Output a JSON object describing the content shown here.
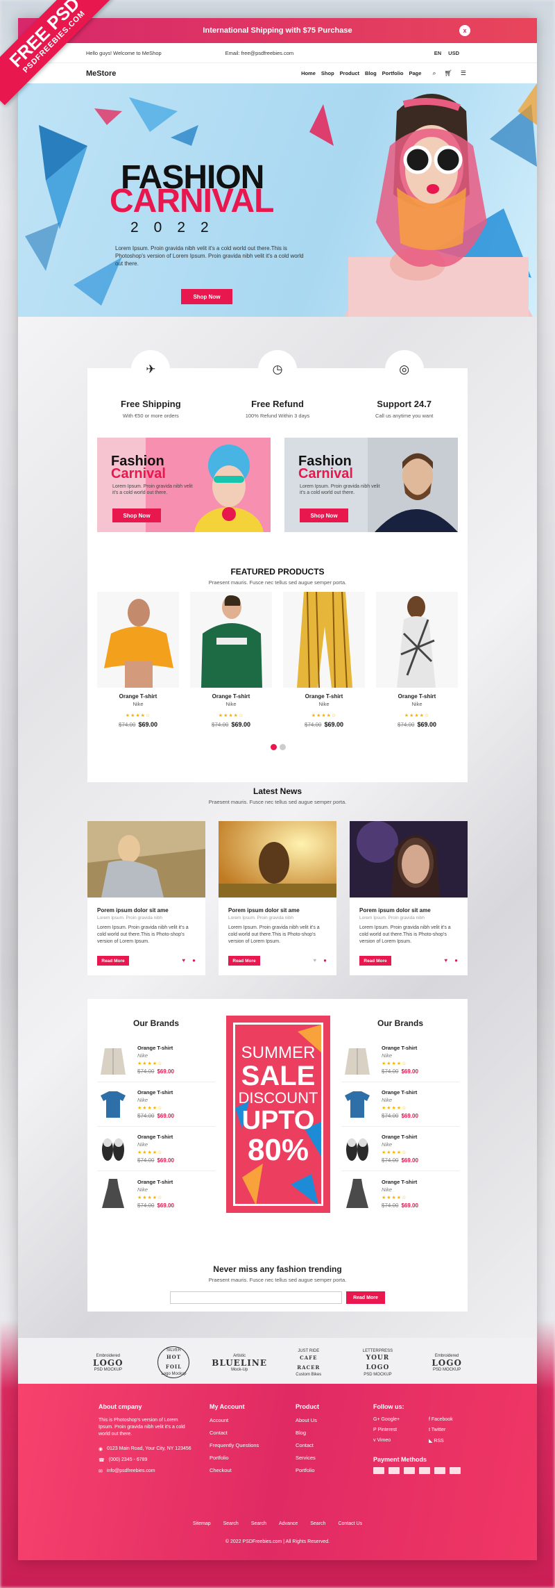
{
  "badge": {
    "line1": "FREE PSD",
    "line2": "PSDFREEBIES.COM"
  },
  "promo": {
    "text": "International Shipping with $75 Purchase",
    "close": "x"
  },
  "topbar": {
    "welcome": "Hello guys! Welcome to MeShop",
    "email": "Email: free@psdfreebies.com",
    "lang": "EN",
    "currency": "USD"
  },
  "nav": {
    "logo": "MeStore",
    "items": [
      "Home",
      "Shop",
      "Product",
      "Blog",
      "Portfolio",
      "Page"
    ]
  },
  "hero": {
    "line1": "FASHION",
    "line2": "CARNIVAL",
    "year": "2022",
    "text": "Lorem Ipsum. Proin gravida nibh velit it's a cold world out there.This is Photoshop's version of Lorem Ipsum. Proin gravida nibh velit it's a cold world out there.",
    "button": "Shop Now"
  },
  "services": [
    {
      "title": "Free Shipping",
      "sub": "With €50 or more orders",
      "icon": "plane-icon"
    },
    {
      "title": "Free Refund",
      "sub": "100% Refund Within 3 days",
      "icon": "clock-icon"
    },
    {
      "title": "Support 24.7",
      "sub": "Call us anytime you want",
      "icon": "lifebuoy-icon"
    }
  ],
  "banners": [
    {
      "line1": "Fashion",
      "line2": "Carnival",
      "text": "Lorem Ipsum. Proin gravida nibh velit it's a cold world out there.",
      "button": "Shop Now"
    },
    {
      "line1": "Fashion",
      "line2": "Carnival",
      "text": "Lorem Ipsum. Proin gravida nibh velit it's a cold world out there.",
      "button": "Shop Now"
    }
  ],
  "featured": {
    "title": "FEATURED PRODUCTS",
    "sub": "Praesent mauris. Fusce nec tellus sed augue semper porta.",
    "products": [
      {
        "name": "Orange T-shirt",
        "brand": "Nike",
        "old": "$74.00",
        "price": "$69.00"
      },
      {
        "name": "Orange T-shirt",
        "brand": "Nike",
        "old": "$74.00",
        "price": "$69.00"
      },
      {
        "name": "Orange T-shirt",
        "brand": "Nike",
        "old": "$74.00",
        "price": "$69.00"
      },
      {
        "name": "Orange T-shirt",
        "brand": "Nike",
        "old": "$74.00",
        "price": "$69.00"
      }
    ]
  },
  "news": {
    "title": "Latest News",
    "sub": "Praesent mauris. Fusce nec tellus sed augue semper porta.",
    "items": [
      {
        "title": "Porem ipsum dolor sit ame",
        "sub": "Lorem Ipsum. Proin gravida nibh",
        "text": "Lorem Ipsum. Proin gravida nibh velit it's a cold world out there.This is Photo-shop's version of Lorem Ipsum.",
        "button": "Read More"
      },
      {
        "title": "Porem ipsum dolor sit ame",
        "sub": "Lorem Ipsum. Proin gravida nibh",
        "text": "Lorem Ipsum. Proin gravida nibh velit it's a cold world out there.This is Photo-shop's version of Lorem Ipsum.",
        "button": "Read More"
      },
      {
        "title": "Porem ipsum dolor sit ame",
        "sub": "Lorem Ipsum. Proin gravida nibh",
        "text": "Lorem Ipsum. Proin gravida nibh velit it's a cold world out there.This is Photo-shop's version of Lorem Ipsum.",
        "button": "Read More"
      }
    ]
  },
  "brands": {
    "title": "Our Brands",
    "items": [
      {
        "name": "Orange T-shirt",
        "brand": "Nike",
        "old": "$74.00",
        "price": "$69.00"
      },
      {
        "name": "Orange T-shirt",
        "brand": "Nike",
        "old": "$74.00",
        "price": "$69.00"
      },
      {
        "name": "Orange T-shirt",
        "brand": "Nike",
        "old": "$74.00",
        "price": "$69.00"
      },
      {
        "name": "Orange T-shirt",
        "brand": "Nike",
        "old": "$74.00",
        "price": "$69.00"
      }
    ]
  },
  "sale": {
    "l1": "SUMMER",
    "l2": "SALE",
    "l3": "DISCOUNT",
    "l4": "UPTO",
    "l5": "80%"
  },
  "newsletter": {
    "title": "Never miss any fashion trending",
    "sub": "Praesent mauris. Fusce nec tellus sed augue semper porta.",
    "button": "Read More"
  },
  "logos": [
    {
      "small": "Embroidered",
      "big": "LOGO",
      "foot": "PSD MOCKUP"
    },
    {
      "small": "SILVER",
      "big": "HOT FOIL",
      "foot": "Logo Mockup"
    },
    {
      "small": "Artistic",
      "big": "BLUELINE",
      "foot": "Mock-Up"
    },
    {
      "small": "JUST RIDE",
      "big": "CAFE RACER",
      "foot": "Custom Bikes"
    },
    {
      "small": "LETTERPRESS",
      "big": "YOUR LOGO",
      "foot": "PSD MOCKUP"
    },
    {
      "small": "Embroidered",
      "big": "LOGO",
      "foot": "PSD MOCKUP"
    }
  ],
  "footer": {
    "about": {
      "title": "About cmpany",
      "text": "This is Photoshop's version of Lorem Ipsum. Proin gravida nibh velit it's a cold world out there.",
      "address": "0123 Main Road, Your City, NY 123456",
      "phone": "(000) 2345 - 6789",
      "email": "info@psdfreebies.com"
    },
    "account": {
      "title": "My Account",
      "items": [
        "Account",
        "Contact",
        "Frequently Questions",
        "Portfolio",
        "Checkout"
      ]
    },
    "product": {
      "title": "Product",
      "items": [
        "About Us",
        "Blog",
        "Contact",
        "Services",
        "Portfolio"
      ]
    },
    "follow": {
      "title": "Follow us:",
      "items": [
        "Google+",
        "Facebook",
        "Pinterest",
        "Twitter",
        "Vimeo",
        "RSS"
      ]
    },
    "payment": {
      "title": "Payment Methods"
    },
    "links": [
      "Sitemap",
      "Search",
      "Search",
      "Advance",
      "Search",
      "Contact Us"
    ],
    "copyright": "© 2022  PSDFreebies.com  |  All Rights Reserved."
  },
  "colors": {
    "accent": "#e8174d"
  }
}
